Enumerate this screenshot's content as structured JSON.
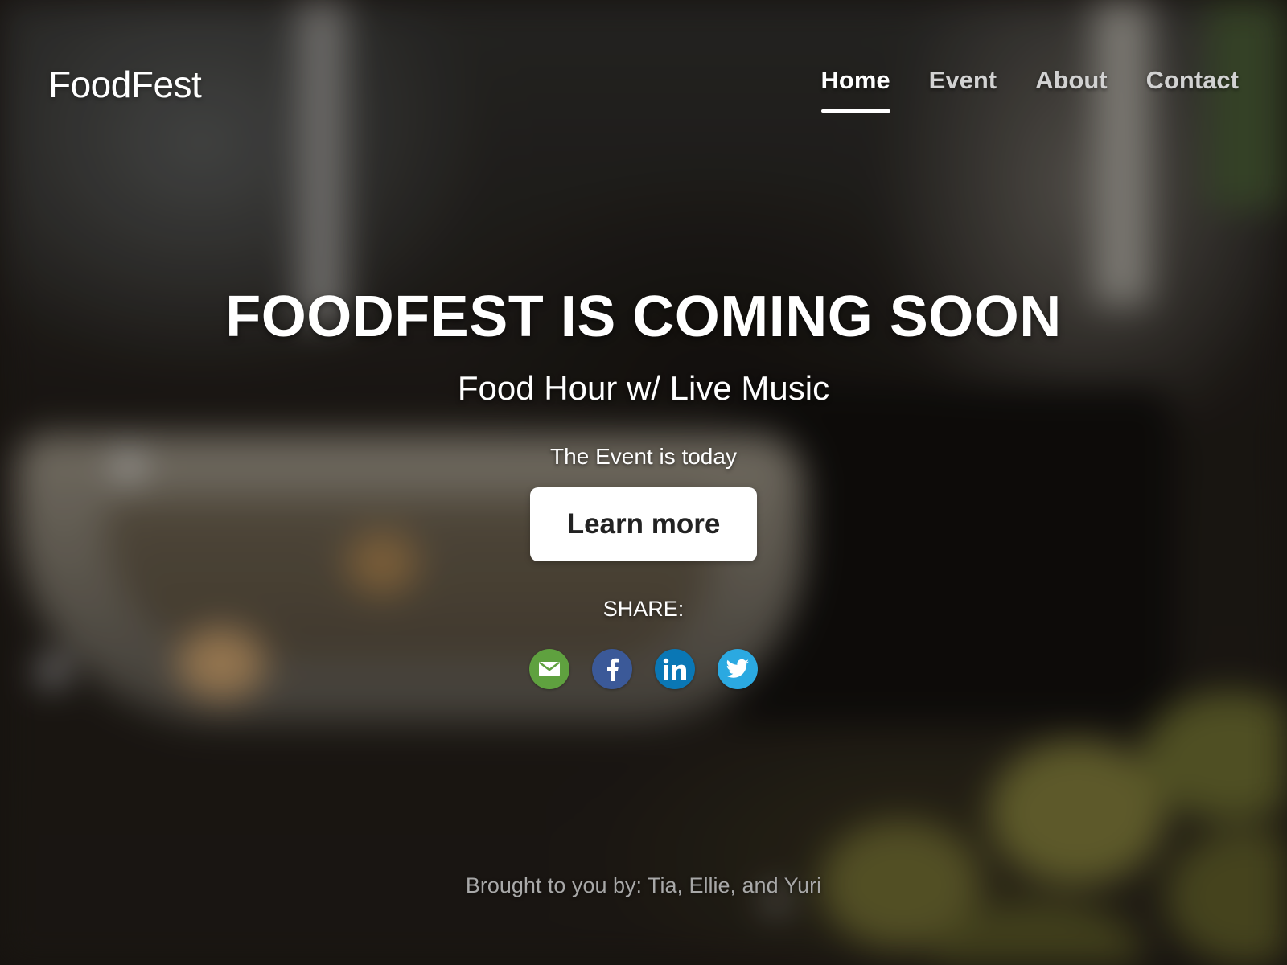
{
  "header": {
    "logo": "FoodFest",
    "nav": [
      {
        "label": "Home",
        "active": true
      },
      {
        "label": "Event",
        "active": false
      },
      {
        "label": "About",
        "active": false
      },
      {
        "label": "Contact",
        "active": false
      }
    ]
  },
  "hero": {
    "title": "FOODFEST IS COMING SOON",
    "subtitle": "Food Hour w/ Live Music",
    "date_text": "The Event is today",
    "cta_label": "Learn more",
    "share_label": "SHARE:",
    "share_icons": [
      {
        "name": "email-icon",
        "color": "#5fa13f"
      },
      {
        "name": "facebook-icon",
        "color": "#3b5998"
      },
      {
        "name": "linkedin-icon",
        "color": "#0a77b5"
      },
      {
        "name": "twitter-icon",
        "color": "#2ba9e1"
      }
    ]
  },
  "footer": {
    "credits": "Brought to you by: Tia, Ellie, and Yuri"
  },
  "colors": {
    "text": "#ffffff",
    "nav_inactive": "#d2d2d2",
    "footer_text": "#a8a8a8",
    "button_bg": "#ffffff",
    "button_text": "#222222"
  }
}
